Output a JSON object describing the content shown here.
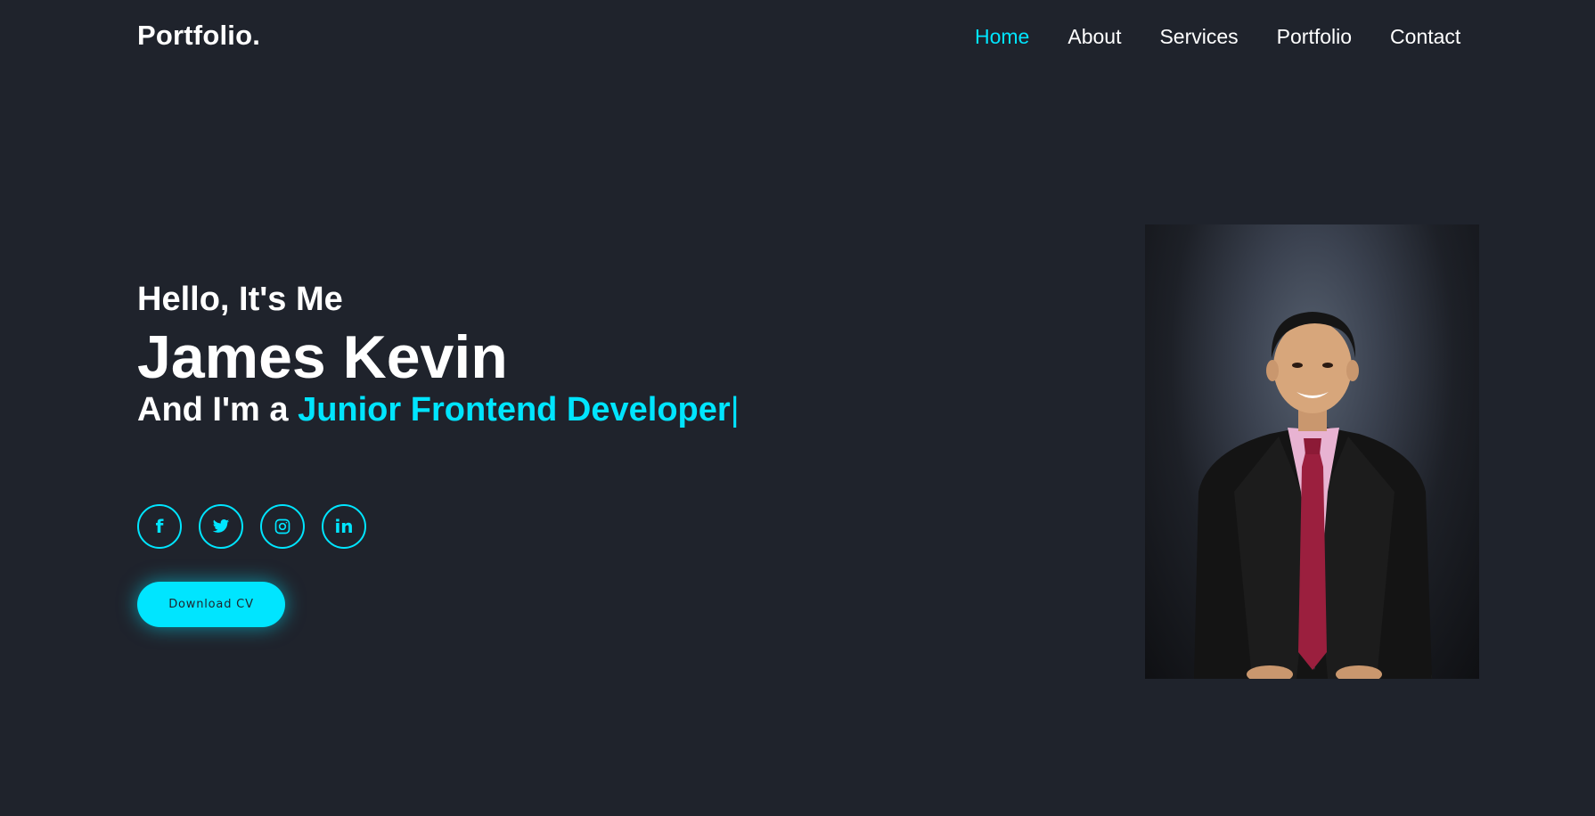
{
  "header": {
    "logo": "Portfolio.",
    "nav": [
      {
        "label": "Home",
        "active": true
      },
      {
        "label": "About",
        "active": false
      },
      {
        "label": "Services",
        "active": false
      },
      {
        "label": "Portfolio",
        "active": false
      },
      {
        "label": "Contact",
        "active": false
      }
    ]
  },
  "hero": {
    "greeting": "Hello, It's Me",
    "name": "James Kevin",
    "role_prefix": "And I'm a ",
    "role_highlight": "Junior Frontend Developer",
    "cursor": "|",
    "socials": [
      {
        "icon": "facebook-icon",
        "glyph": "f"
      },
      {
        "icon": "twitter-icon"
      },
      {
        "icon": "instagram-icon"
      },
      {
        "icon": "linkedin-icon",
        "glyph": "in"
      }
    ],
    "cta_label": "Download CV"
  },
  "colors": {
    "background": "#1f232c",
    "accent": "#00e5ff",
    "text": "#ffffff"
  }
}
